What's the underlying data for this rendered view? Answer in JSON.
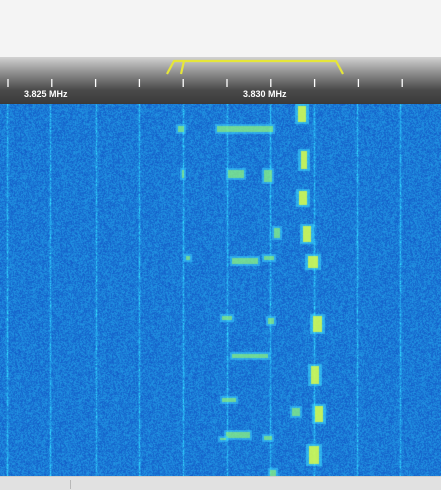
{
  "scale": {
    "labels": [
      "3.825 MHz",
      "3.830 MHz"
    ],
    "label_freqs_mhz": [
      3.825,
      3.83
    ],
    "passband_color": "#e6e639"
  },
  "colors": {
    "waterfall_background": "#1850d8",
    "signal_peak": "#e6ff3c",
    "noise_line": "#38c8ff"
  }
}
